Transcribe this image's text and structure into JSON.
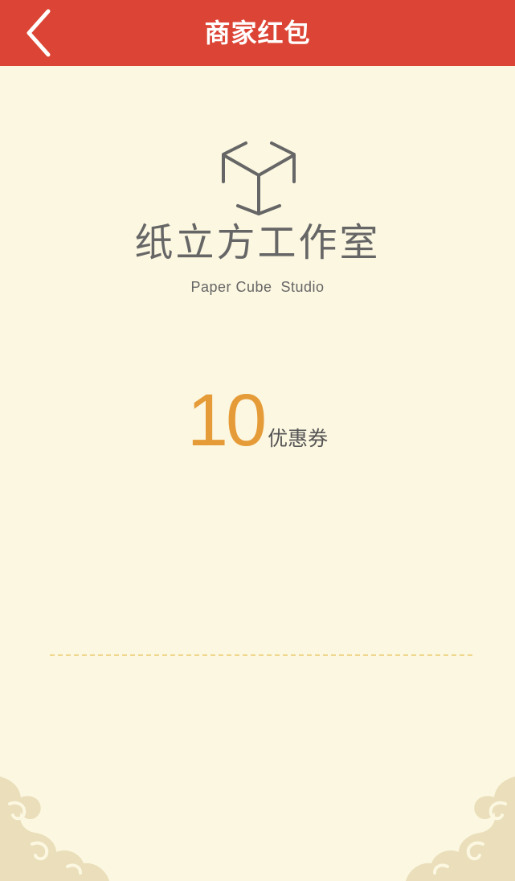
{
  "header": {
    "title": "商家红包",
    "back_icon": "chevron-left-icon",
    "background_color": "#dc4535"
  },
  "merchant": {
    "logo_icon": "cube-icon",
    "name_cn": "纸立方工作室",
    "name_en": "Paper Cube  Studio"
  },
  "coupon": {
    "amount": "10",
    "label": "优惠券",
    "amount_color": "#e59c38"
  },
  "decorations": {
    "cloud_left_icon": "cloud-pattern-icon",
    "cloud_right_icon": "cloud-pattern-icon",
    "page_background": "#fcf7e1"
  }
}
